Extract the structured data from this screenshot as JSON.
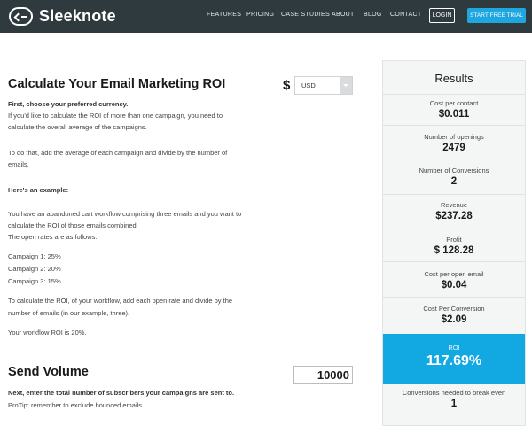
{
  "nav": {
    "logo_text": "Sleeknote",
    "links": [
      "FEATURES",
      "PRICING",
      "CASE STUDIES",
      "ABOUT",
      "BLOG",
      "CONTACT"
    ],
    "login_label": "LOGIN",
    "trial_label": "START FREE TRIAL"
  },
  "calculator": {
    "title": "Calculate Your Email Marketing ROI",
    "currency_symbol": "$",
    "currency_selected": "USD",
    "intro_bold": "First, choose your preferred currency.",
    "intro_line1": "If you'd like to calculate the ROI of more than one campaign, you need to",
    "intro_line2": "calculate the overall average of the campaigns.",
    "todo_line1": "To do that, add the average of each campaign and divide by the number of",
    "todo_line2": "emails.",
    "example_heading": "Here's an example:",
    "example_line1": "You have an abandoned cart workflow comprising three emails and you want to",
    "example_line2": "calculate the ROI of those emails combined.",
    "example_line3": "The open rates are as follows:",
    "campaigns": [
      "Campaign 1: 25%",
      "Campaign 2: 20%",
      "Campaign 3: 15%"
    ],
    "calc_line1": "To calculate the ROI, of your workflow, add each open rate and divide by the",
    "calc_line2": "number of emails (in our example, three).",
    "result_line": "Your workflow ROI is 20%.",
    "send_volume_title": "Send Volume",
    "send_volume_value": "10000",
    "volume_bold": "Next, enter the total number of subscribers your campaigns are sent to.",
    "volume_tip": "ProTip: remember to exclude bounced emails."
  },
  "results": {
    "title": "Results",
    "cost_per_contact_label": "Cost per contact",
    "cost_per_contact_value": "$0.011",
    "openings_label": "Number of openings",
    "openings_value": "2479",
    "conversions_label": "Number of Conversions",
    "conversions_value": "2",
    "revenue_label": "Revenue",
    "revenue_value": "$237.28",
    "profit_label": "Profit",
    "profit_value": "$ 128.28",
    "cost_per_open_label": "Cost per open email",
    "cost_per_open_value": "$0.04",
    "cost_per_conversion_label": "Cost Per Conversion",
    "cost_per_conversion_value": "$2.09",
    "roi_label": "ROI",
    "roi_value": "117.69%",
    "break_even_label": "Conversions needed to break even",
    "break_even_value": "1"
  },
  "colors": {
    "nav_bg": "#2f3a3f",
    "accent": "#12a9e3",
    "panel_bg": "#f4f5f5"
  }
}
